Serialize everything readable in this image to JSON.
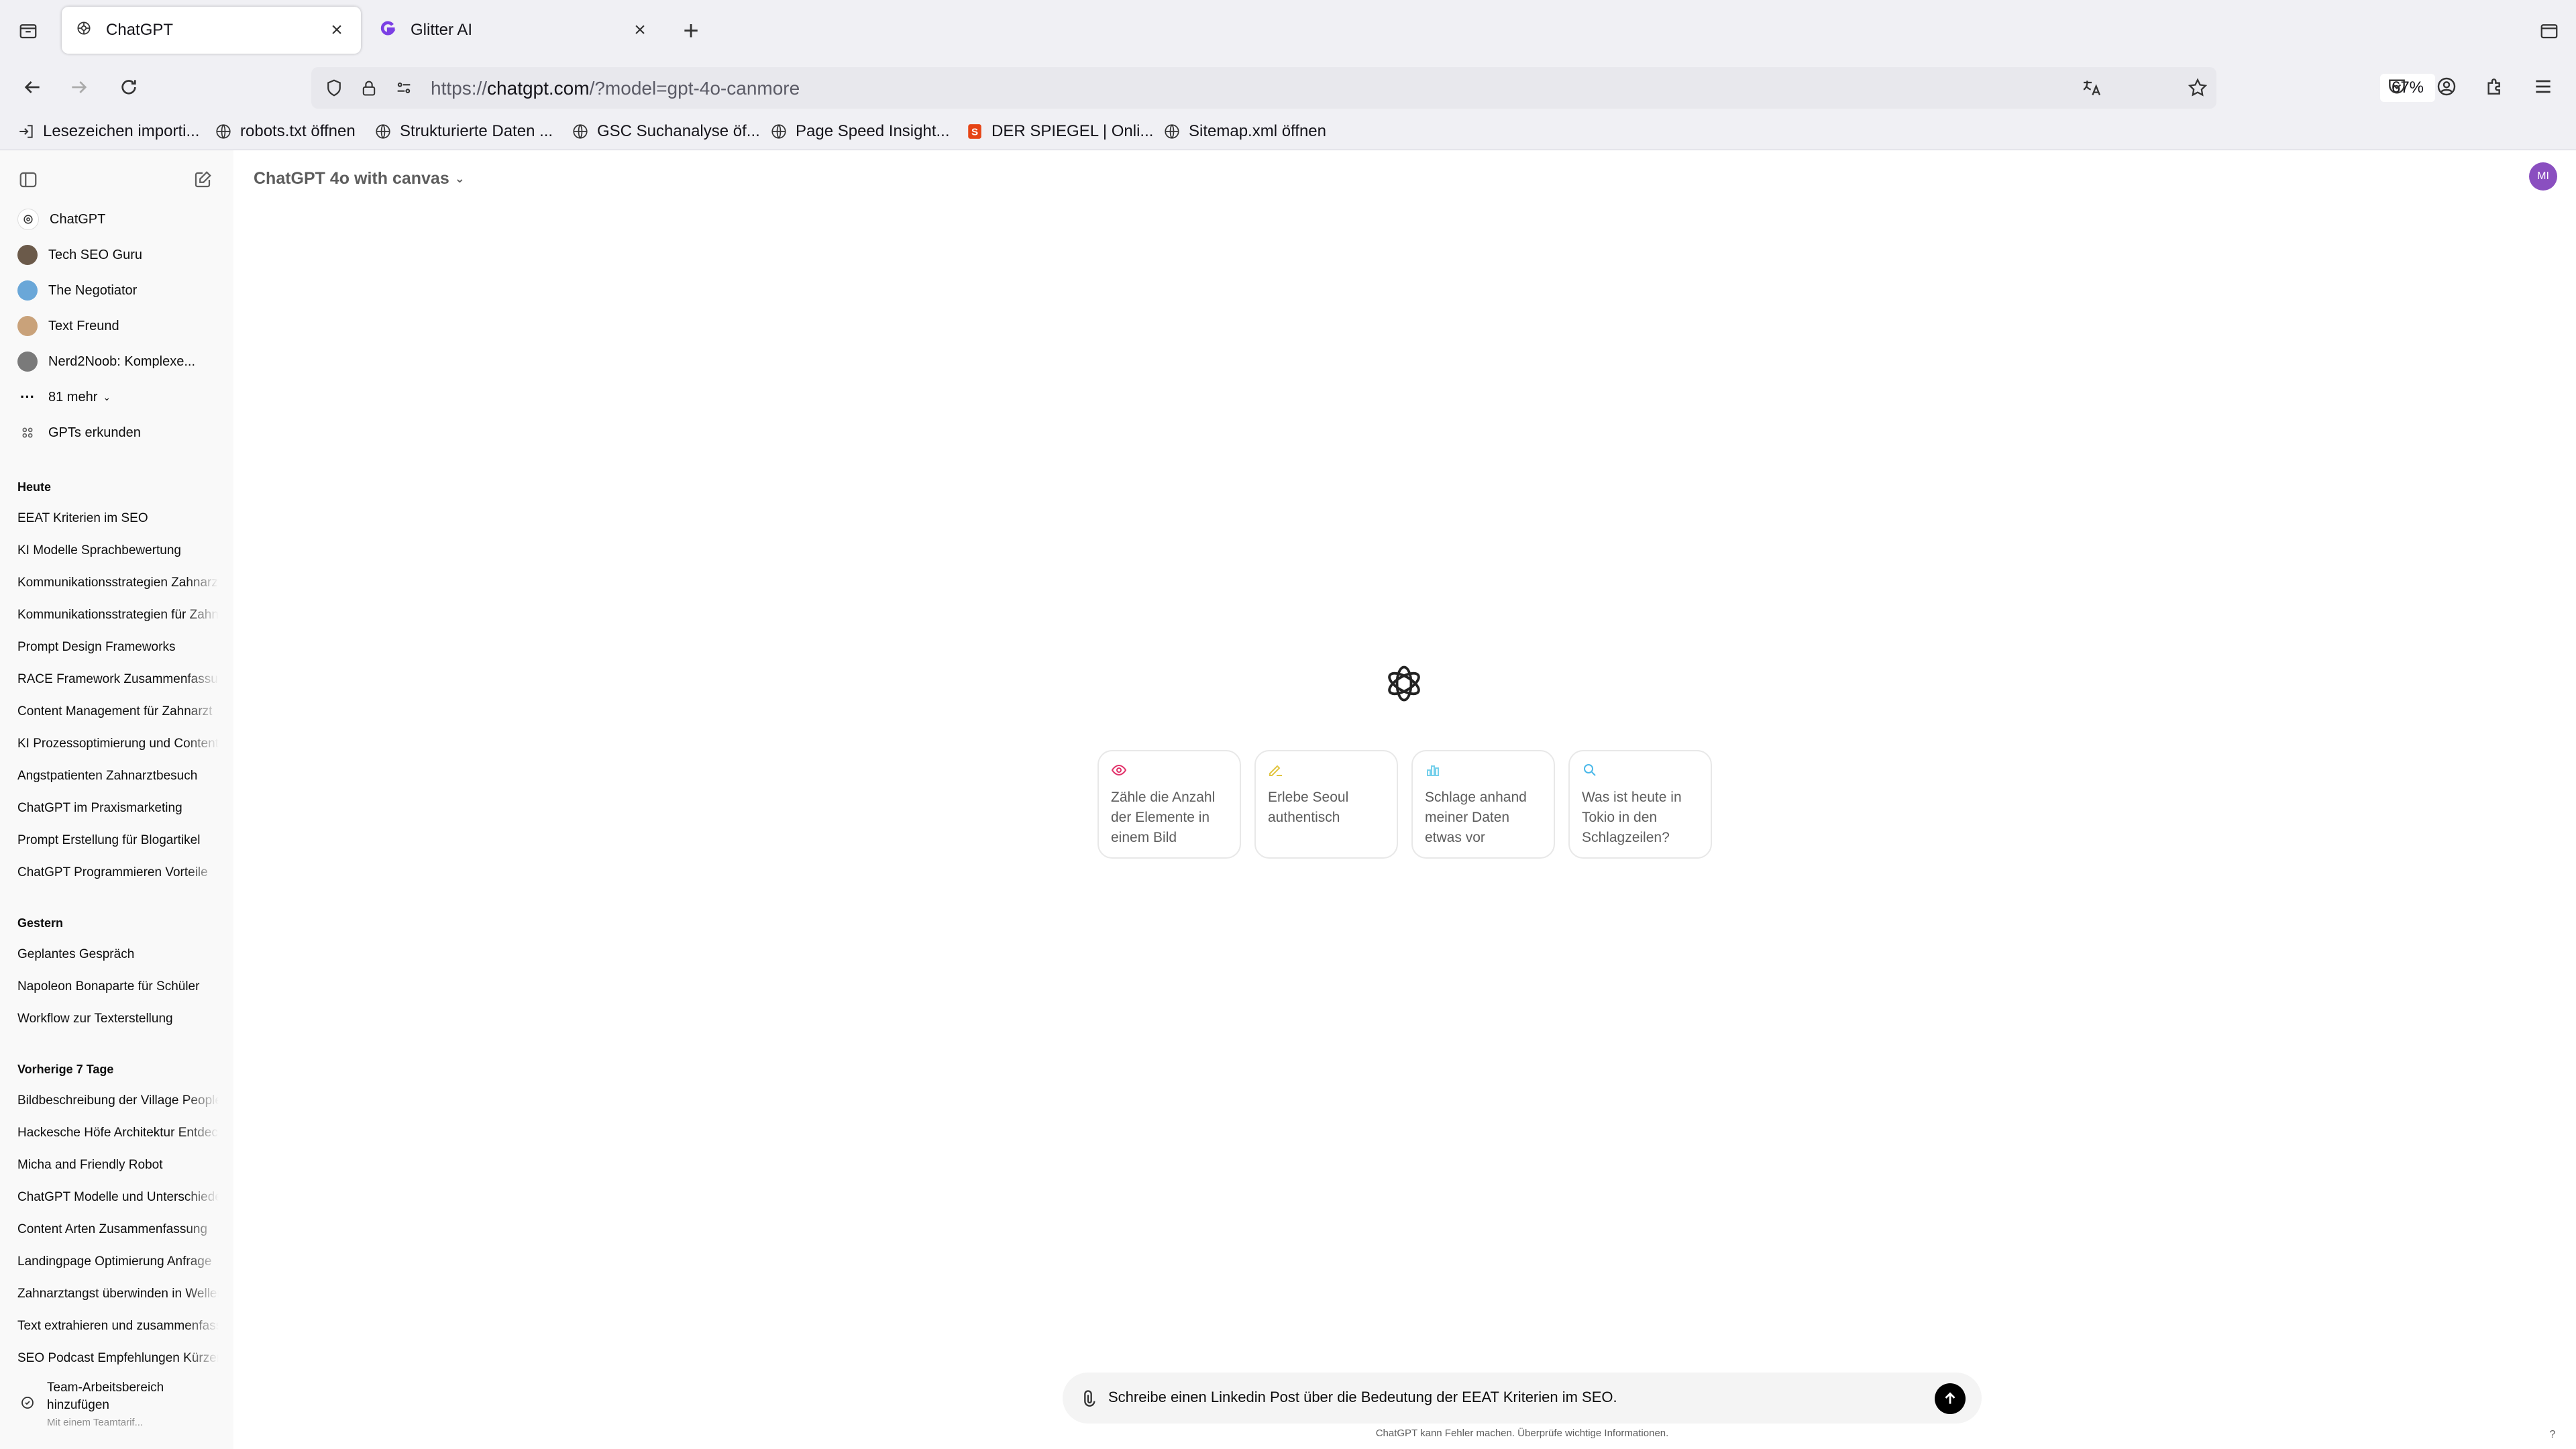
{
  "browser": {
    "tabs": [
      {
        "title": "ChatGPT",
        "active": true
      },
      {
        "title": "Glitter AI",
        "active": false
      }
    ],
    "url": {
      "prefix": "https://",
      "host": "chatgpt.com",
      "path": "/?model=gpt-4o-canmore"
    },
    "zoom": "67%",
    "bookmarks": [
      "Lesezeichen importi...",
      "robots.txt öffnen",
      "Strukturierte Daten ...",
      "GSC Suchanalyse öf...",
      "Page Speed Insight...",
      "DER SPIEGEL | Onli...",
      "Sitemap.xml öffnen"
    ]
  },
  "sidebar": {
    "gpts": [
      {
        "label": "ChatGPT"
      },
      {
        "label": "Tech SEO Guru"
      },
      {
        "label": "The Negotiator"
      },
      {
        "label": "Text Freund"
      },
      {
        "label": "Nerd2Noob: Komplexe..."
      },
      {
        "label": "81 mehr"
      },
      {
        "label": "GPTs erkunden"
      }
    ],
    "sections": [
      {
        "heading": "Heute",
        "items": [
          "EEAT Kriterien im SEO",
          "KI Modelle Sprachbewertung",
          "Kommunikationsstrategien Zahnarzt",
          "Kommunikationsstrategien für Zahnarzt",
          "Prompt Design Frameworks",
          "RACE Framework Zusammenfassung",
          "Content Management für Zahnarzt",
          "KI Prozessoptimierung und Content",
          "Angstpatienten Zahnarztbesuch",
          "ChatGPT im Praxismarketing",
          "Prompt Erstellung für Blogartikel",
          "ChatGPT Programmieren Vorteile"
        ]
      },
      {
        "heading": "Gestern",
        "items": [
          "Geplantes Gespräch",
          "Napoleon Bonaparte für Schüler",
          "Workflow zur Texterstellung"
        ]
      },
      {
        "heading": "Vorherige 7 Tage",
        "items": [
          "Bildbeschreibung der Village People",
          "Hackesche Höfe Architektur Entdecken",
          "Micha and Friendly Robot",
          "ChatGPT Modelle und Unterschiede",
          "Content Arten Zusammenfassung",
          "Landingpage Optimierung Anfrage",
          "Zahnarztangst überwinden in Wellen",
          "Text extrahieren und zusammenfassen",
          "SEO Podcast Empfehlungen Kürzen"
        ]
      }
    ],
    "team": {
      "title": "Team-Arbeitsbereich hinzufügen",
      "subtitle": "Mit einem Teamtarif..."
    }
  },
  "main": {
    "model": "ChatGPT 4o with canvas",
    "avatar_initials": "MI",
    "suggestions": [
      {
        "text": "Zähle die Anzahl der Elemente in einem Bild",
        "icon": "eye-icon",
        "color": "#e2336b"
      },
      {
        "text": "Erlebe Seoul authentisch",
        "icon": "pen-icon",
        "color": "#e2c541"
      },
      {
        "text": "Schlage anhand meiner Daten etwas vor",
        "icon": "chart-icon",
        "color": "#76d0eb"
      },
      {
        "text": "Was ist heute in Tokio in den Schlagzeilen?",
        "icon": "search-icon",
        "color": "#4ab8e9"
      }
    ],
    "composer_text": "Schreibe einen Linkedin Post über die Bedeutung der EEAT Kriterien im SEO.",
    "disclaimer": "ChatGPT kann Fehler machen. Überprüfe wichtige Informationen.",
    "help": "?"
  }
}
